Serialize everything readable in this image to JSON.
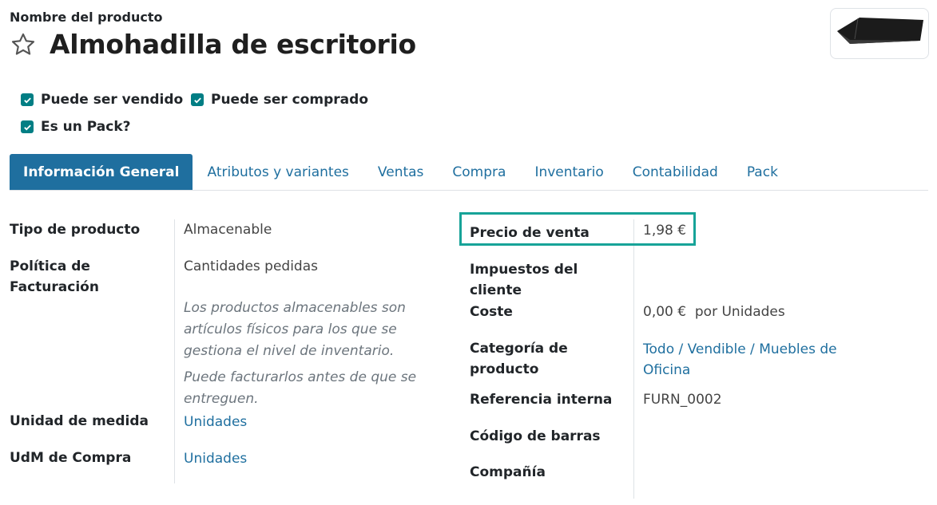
{
  "header": {
    "field_label": "Nombre del producto",
    "title": "Almohadilla de escritorio",
    "favorite_icon": "star-outline-icon",
    "image_icon": "desk-pad-image"
  },
  "checkboxes": {
    "sale_ok": {
      "label": "Puede ser vendido",
      "checked": true
    },
    "purchase_ok": {
      "label": "Puede ser comprado",
      "checked": true
    },
    "is_pack": {
      "label": "Es un Pack?",
      "checked": true
    }
  },
  "tabs": [
    {
      "label": "Información General",
      "active": true
    },
    {
      "label": "Atributos y variantes",
      "active": false
    },
    {
      "label": "Ventas",
      "active": false
    },
    {
      "label": "Compra",
      "active": false
    },
    {
      "label": "Inventario",
      "active": false
    },
    {
      "label": "Contabilidad",
      "active": false
    },
    {
      "label": "Pack",
      "active": false
    }
  ],
  "left": {
    "tipo_label": "Tipo de producto",
    "tipo_value": "Almacenable",
    "politica_label_1": "Política de",
    "politica_label_2": "Facturación",
    "politica_value": "Cantidades pedidas",
    "help_1": [
      "Los productos almacenables son",
      "artículos físicos para los que se",
      "gestiona el nivel de inventario."
    ],
    "help_2": [
      "Puede facturarlos antes de que se",
      "entreguen."
    ],
    "uom_label": "Unidad de medida",
    "uom_value": "Unidades",
    "uom_po_label": "UdM de Compra",
    "uom_po_value": "Unidades"
  },
  "right": {
    "precio_label": "Precio de venta",
    "precio_value": "1,98 €",
    "impuestos_label_1": "Impuestos del",
    "impuestos_label_2": "cliente",
    "coste_label": "Coste",
    "coste_value": "0,00 €",
    "coste_unit": "por Unidades",
    "categoria_label_1": "Categoría de",
    "categoria_label_2": "producto",
    "categoria_value_1": "Todo / Vendible / Muebles de",
    "categoria_value_2": "Oficina",
    "ref_label": "Referencia interna",
    "ref_value": "FURN_0002",
    "barcode_label": "Código de barras",
    "company_label": "Compañía"
  },
  "colors": {
    "accent": "#1f6f9f",
    "checkbox": "#017e84",
    "highlight": "#17a398"
  }
}
